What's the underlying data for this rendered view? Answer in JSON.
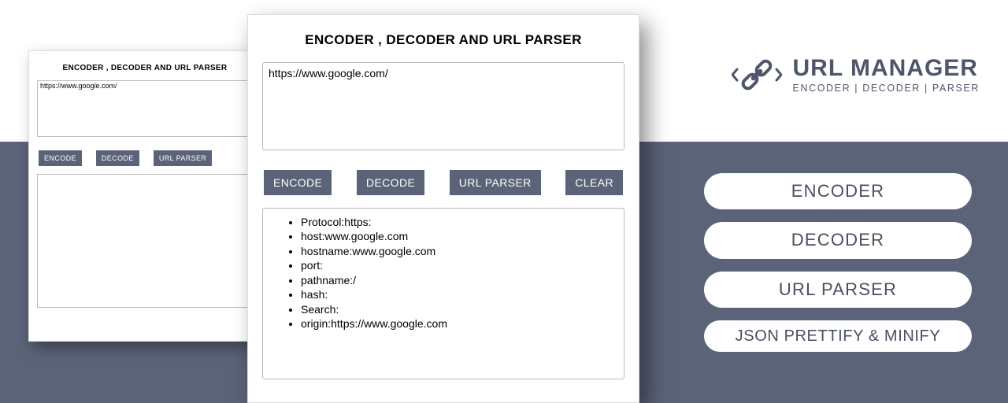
{
  "title": "ENCODER , DECODER AND URL PARSER",
  "input_url": "https://www.google.com/",
  "buttons": {
    "encode": "ENCODE",
    "decode": "DECODE",
    "parser": "URL PARSER",
    "clear": "CLEAR"
  },
  "parsed": [
    "Protocol:https:",
    "host:www.google.com",
    "hostname:www.google.com",
    "port:",
    "pathname:/",
    "hash:",
    "Search:",
    "origin:https://www.google.com"
  ],
  "brand": {
    "name": "URL MANAGER",
    "tagline": "ENCODER | DECODER | PARSER"
  },
  "pills": [
    "ENCODER",
    "DECODER",
    "URL PARSER",
    "JSON PRETTIFY & MINIFY"
  ]
}
